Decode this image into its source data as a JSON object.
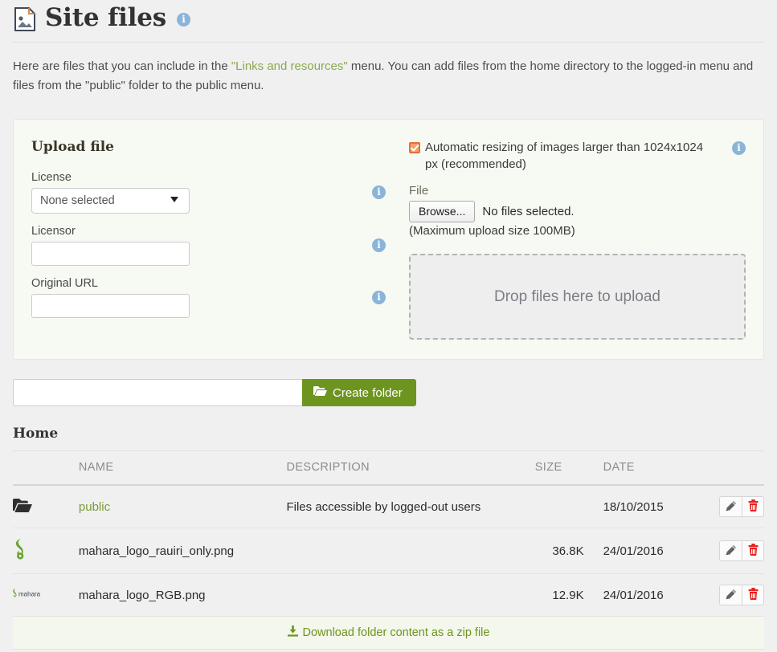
{
  "header": {
    "title": "Site files",
    "icon": "image-file-icon",
    "info_icon": "info-icon",
    "info_label": "i"
  },
  "intro": {
    "text_before": "Here are files that you can include in the ",
    "link_text": "\"Links and resources\"",
    "text_after": " menu. You can add files from the home directory to the logged-in menu and files from the \"public\" folder to the public menu."
  },
  "upload": {
    "panel_title": "Upload file",
    "license": {
      "label": "License",
      "selected": "None selected",
      "options": [
        "None selected"
      ],
      "info_label": "i"
    },
    "licensor": {
      "label": "Licensor",
      "value": "",
      "info_label": "i"
    },
    "original_url": {
      "label": "Original URL",
      "value": "",
      "info_label": "i"
    },
    "resize": {
      "checked": true,
      "label": "Automatic resizing of images larger than 1024x1024 px (recommended)",
      "info_label": "i"
    },
    "file": {
      "label": "File",
      "browse_label": "Browse...",
      "status": "No files selected.",
      "max_size": "(Maximum upload size 100MB)"
    },
    "dropzone": {
      "text": "Drop files here to upload"
    }
  },
  "create_folder": {
    "input_value": "",
    "input_placeholder": "",
    "button_label": "Create folder",
    "button_icon": "folder-open-icon",
    "button_color": "#6e9420"
  },
  "listing": {
    "heading": "Home",
    "columns": [
      "",
      "NAME",
      "DESCRIPTION",
      "SIZE",
      "DATE",
      ""
    ],
    "rows": [
      {
        "icon": "folder-open-icon",
        "name": "public",
        "is_link": true,
        "description": "Files accessible by logged-out users",
        "size": "",
        "date": "18/10/2015",
        "edit_label": "edit-icon",
        "delete_label": "delete-icon"
      },
      {
        "icon": "image-thumbnail-koru",
        "name": "mahara_logo_rauiri_only.png",
        "is_link": false,
        "description": "",
        "size": "36.8K",
        "date": "24/01/2016",
        "edit_label": "edit-icon",
        "delete_label": "delete-icon"
      },
      {
        "icon": "image-thumbnail-mahara",
        "name": "mahara_logo_RGB.png",
        "is_link": false,
        "description": "",
        "size": "12.9K",
        "date": "24/01/2016",
        "edit_label": "edit-icon",
        "delete_label": "delete-icon"
      }
    ]
  },
  "footer": {
    "download_label": "Download folder content as a zip file",
    "download_icon": "download-icon"
  },
  "colors": {
    "green_link": "#7a9b3a",
    "green_button": "#6e9420",
    "info_blue": "#8ab4d8",
    "checkbox_orange": "#e2703a",
    "delete_red": "#e8201f",
    "page_bg": "#f0f0f0",
    "panel_bg": "#f7faf2"
  }
}
